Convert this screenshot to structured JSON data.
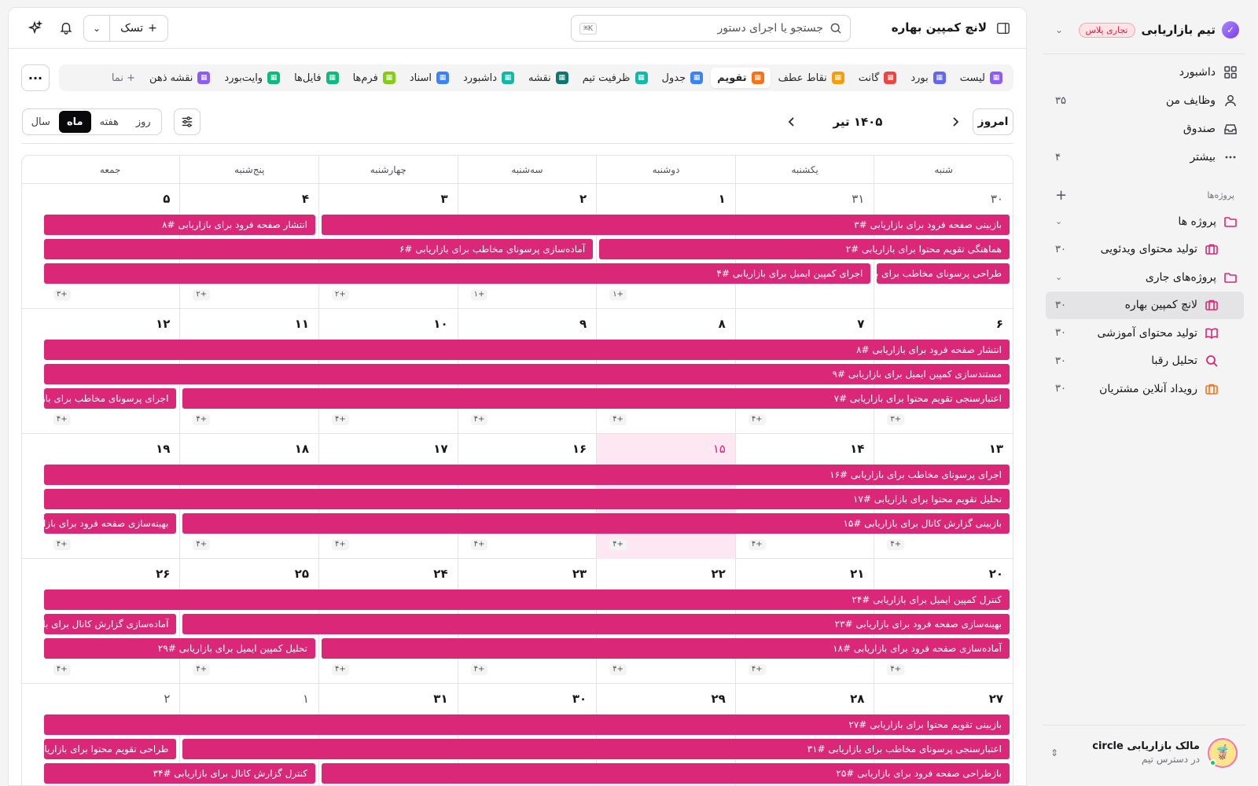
{
  "colors": {
    "accent": "#db2777",
    "today_bg": "#fce7f3",
    "plan_badge": "#e11d48"
  },
  "sidebar": {
    "team_name": "تیم بازاریابی",
    "plan_badge": "تجاری پلاس",
    "nav": [
      {
        "label": "داشبورد",
        "icon": "grid-icon",
        "count": ""
      },
      {
        "label": "وظایف من",
        "icon": "user-icon",
        "count": "۳۵"
      },
      {
        "label": "صندوق",
        "icon": "inbox-icon",
        "count": ""
      },
      {
        "label": "بیشتر",
        "icon": "more-icon",
        "count": "۴"
      }
    ],
    "projects_header": "پروژه‌ها",
    "projects": [
      {
        "label": "پروژه ها",
        "kind": "folder",
        "count": "",
        "sub": false,
        "active": false,
        "color": "#db2777"
      },
      {
        "label": "تولید محتوای ویدئویی",
        "kind": "briefcase",
        "count": "۳۰",
        "sub": true,
        "active": false,
        "color": "#db2777"
      },
      {
        "label": "پروژه‌های جاری",
        "kind": "folder",
        "count": "",
        "sub": false,
        "active": false,
        "color": "#db2777"
      },
      {
        "label": "لانچ کمپین بهاره",
        "kind": "briefcase",
        "count": "۳۰",
        "sub": true,
        "active": true,
        "color": "#db2777"
      },
      {
        "label": "تولید محتوای آموزشی",
        "kind": "book",
        "count": "۳۰",
        "sub": true,
        "active": false,
        "color": "#db2777"
      },
      {
        "label": "تحلیل رقبا",
        "kind": "search",
        "count": "۳۰",
        "sub": true,
        "active": false,
        "color": "#db2777"
      },
      {
        "label": "رویداد آنلاین مشتریان",
        "kind": "briefcase",
        "count": "۳۰",
        "sub": true,
        "active": false,
        "color": "#f97316"
      }
    ],
    "user": {
      "name": "مالک بازاریابی circle",
      "subtitle": "در دسترس تیم"
    }
  },
  "topbar": {
    "title": "لانچ کمپین بهاره",
    "search_placeholder": "جستجو یا اجرای دستور",
    "search_shortcut": "⌘K",
    "task_label": "تسک"
  },
  "views": [
    {
      "label": "لیست",
      "color": "#8b5cf6",
      "active": false
    },
    {
      "label": "بورد",
      "color": "#6366f1",
      "active": false
    },
    {
      "label": "گانت",
      "color": "#ef4444",
      "active": false
    },
    {
      "label": "نقاط عطف",
      "color": "#f59e0b",
      "active": false
    },
    {
      "label": "تقویم",
      "color": "#f97316",
      "active": true
    },
    {
      "label": "جدول",
      "color": "#3b82f6",
      "active": false
    },
    {
      "label": "ظرفیت تیم",
      "color": "#14b8a6",
      "active": false
    },
    {
      "label": "نقشه",
      "color": "#0f766e",
      "active": false
    },
    {
      "label": "داشبورد",
      "color": "#14b8a6",
      "active": false
    },
    {
      "label": "اسناد",
      "color": "#3b82f6",
      "active": false
    },
    {
      "label": "فرم‌ها",
      "color": "#84cc16",
      "active": false
    },
    {
      "label": "فایل‌ها",
      "color": "#10b981",
      "active": false
    },
    {
      "label": "وایت‌بورد",
      "color": "#10b981",
      "active": false
    },
    {
      "label": "نقشه ذهن",
      "color": "#8b5cf6",
      "active": false
    },
    {
      "label": "+ نما",
      "color": "",
      "active": false
    }
  ],
  "calendar": {
    "today_label": "امروز",
    "month_title": "۱۴۰۵ تیر",
    "modes": [
      {
        "label": "روز",
        "active": false
      },
      {
        "label": "هفته",
        "active": false
      },
      {
        "label": "ماه",
        "active": true
      },
      {
        "label": "سال",
        "active": false
      }
    ],
    "weekdays": [
      "شنبه",
      "یکشنبه",
      "دوشنبه",
      "سه‌شنبه",
      "چهارشنبه",
      "پنج‌شنبه",
      "جمعه"
    ],
    "weeks": [
      {
        "days": [
          {
            "num": "۳۰",
            "muted": true,
            "more": ""
          },
          {
            "num": "۳۱",
            "muted": true,
            "more": ""
          },
          {
            "num": "۱",
            "more": "+۱"
          },
          {
            "num": "۲",
            "more": "+۱"
          },
          {
            "num": "۳",
            "more": "+۲"
          },
          {
            "num": "۴",
            "more": "+۲"
          },
          {
            "num": "۵",
            "more": "+۳"
          }
        ],
        "events": [
          {
            "title": "بازبینی صفحه فرود برای بازاریابی #۳",
            "start": 0,
            "span": 5,
            "row": 0
          },
          {
            "title": "انتشار صفحه فرود برای بازاریابی #۸",
            "start": 5,
            "span": 2,
            "row": 0
          },
          {
            "title": "هماهنگی تقویم محتوا برای بازاریابی #۲",
            "start": 0,
            "span": 3,
            "row": 1
          },
          {
            "title": "آماده‌سازی پرسونای مخاطب برای بازاریابی #۶",
            "start": 3,
            "span": 4,
            "row": 1
          },
          {
            "title": "طراحی پرسونای مخاطب برای باز...",
            "start": 0,
            "span": 1,
            "row": 2
          },
          {
            "title": "اجرای کمپین ایمیل برای بازاریابی #۴",
            "start": 1,
            "span": 6,
            "row": 2
          }
        ]
      },
      {
        "days": [
          {
            "num": "۶",
            "more": "+۳"
          },
          {
            "num": "۷",
            "more": "+۴"
          },
          {
            "num": "۸",
            "more": "+۴"
          },
          {
            "num": "۹",
            "more": "+۴"
          },
          {
            "num": "۱۰",
            "more": "+۴"
          },
          {
            "num": "۱۱",
            "more": "+۴"
          },
          {
            "num": "۱۲",
            "more": "+۴"
          }
        ],
        "events": [
          {
            "title": "انتشار صفحه فرود برای بازاریابی #۸",
            "start": 0,
            "span": 7,
            "row": 0
          },
          {
            "title": "مستندسازی کمپین ایمیل برای بازاریابی #۹",
            "start": 0,
            "span": 7,
            "row": 1
          },
          {
            "title": "اعتبارسنجی تقویم محتوا برای بازاریابی #۷",
            "start": 0,
            "span": 6,
            "row": 2
          },
          {
            "title": "اجرای پرسونای مخاطب برای بازا...",
            "start": 6,
            "span": 1,
            "row": 2
          }
        ]
      },
      {
        "days": [
          {
            "num": "۱۳",
            "more": "+۴"
          },
          {
            "num": "۱۴",
            "more": "+۴"
          },
          {
            "num": "۱۵",
            "today": true,
            "more": "+۴"
          },
          {
            "num": "۱۶",
            "more": "+۴"
          },
          {
            "num": "۱۷",
            "more": "+۴"
          },
          {
            "num": "۱۸",
            "more": "+۴"
          },
          {
            "num": "۱۹",
            "more": "+۴"
          }
        ],
        "events": [
          {
            "title": "اجرای پرسونای مخاطب برای بازاریابی #۱۶",
            "start": 0,
            "span": 7,
            "row": 0
          },
          {
            "title": "تحلیل تقویم محتوا برای بازاریابی #۱۷",
            "start": 0,
            "span": 7,
            "row": 1
          },
          {
            "title": "بازبینی گزارش کانال برای بازاریابی #۱۵",
            "start": 0,
            "span": 6,
            "row": 2
          },
          {
            "title": "بهینه‌سازی صفحه فرود برای بازا...",
            "start": 6,
            "span": 1,
            "row": 2
          }
        ]
      },
      {
        "days": [
          {
            "num": "۲۰",
            "more": "+۴"
          },
          {
            "num": "۲۱",
            "more": "+۴"
          },
          {
            "num": "۲۲",
            "more": "+۴"
          },
          {
            "num": "۲۳",
            "more": "+۴"
          },
          {
            "num": "۲۴",
            "more": "+۴"
          },
          {
            "num": "۲۵",
            "more": "+۴"
          },
          {
            "num": "۲۶",
            "more": "+۴"
          }
        ],
        "events": [
          {
            "title": "کنترل کمپین ایمیل برای بازاریابی #۲۴",
            "start": 0,
            "span": 7,
            "row": 0
          },
          {
            "title": "بهینه‌سازی صفحه فرود برای بازاریابی #۲۳",
            "start": 0,
            "span": 6,
            "row": 1
          },
          {
            "title": "آماده‌سازی گزارش کانال برای باز...",
            "start": 6,
            "span": 1,
            "row": 1
          },
          {
            "title": "آماده‌سازی صفحه فرود برای بازاریابی #۱۸",
            "start": 0,
            "span": 5,
            "row": 2
          },
          {
            "title": "تحلیل کمپین ایمیل برای بازاریابی #۲۹",
            "start": 5,
            "span": 2,
            "row": 2
          }
        ]
      },
      {
        "days": [
          {
            "num": "۲۷",
            "more": ""
          },
          {
            "num": "۲۸",
            "more": ""
          },
          {
            "num": "۲۹",
            "more": ""
          },
          {
            "num": "۳۰",
            "more": ""
          },
          {
            "num": "۳۱",
            "more": ""
          },
          {
            "num": "۱",
            "muted": true,
            "more": ""
          },
          {
            "num": "۲",
            "muted": true,
            "more": ""
          }
        ],
        "events": [
          {
            "title": "بازبینی تقویم محتوا برای بازاریابی #۲۷",
            "start": 0,
            "span": 7,
            "row": 0
          },
          {
            "title": "اعتبارسنجی پرسونای مخاطب برای بازاریابی #۳۱",
            "start": 0,
            "span": 6,
            "row": 1
          },
          {
            "title": "طراحی تقویم محتوا برای بازاریا...",
            "start": 6,
            "span": 1,
            "row": 1
          },
          {
            "title": "بازطراحی صفحه فرود برای بازاریابی #۲۵",
            "start": 0,
            "span": 5,
            "row": 2
          },
          {
            "title": "کنترل گزارش کانال برای بازاریابی #۳۴",
            "start": 5,
            "span": 2,
            "row": 2
          }
        ]
      }
    ]
  }
}
